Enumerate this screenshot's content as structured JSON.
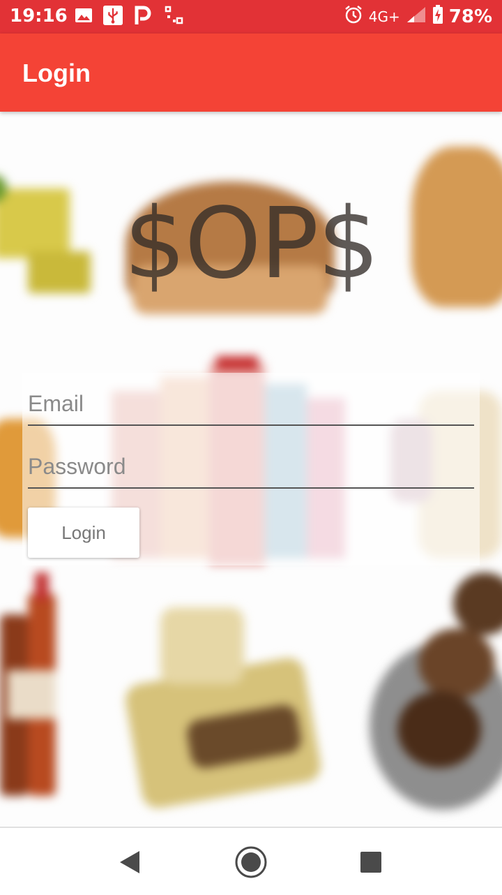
{
  "status_bar": {
    "time": "19:16",
    "network": "4G+",
    "battery": "78%",
    "icons": [
      "image-icon",
      "usb-icon",
      "parking-icon",
      "qr-icon",
      "alarm-icon",
      "signal-icon",
      "battery-charging-icon"
    ]
  },
  "app_bar": {
    "title": "Login",
    "color": "#f44336"
  },
  "logo": {
    "text": "$OP$"
  },
  "form": {
    "email_placeholder": "Email",
    "password_placeholder": "Password",
    "login_label": "Login"
  },
  "nav": {
    "icons": [
      "back-icon",
      "home-icon",
      "recents-icon"
    ]
  }
}
